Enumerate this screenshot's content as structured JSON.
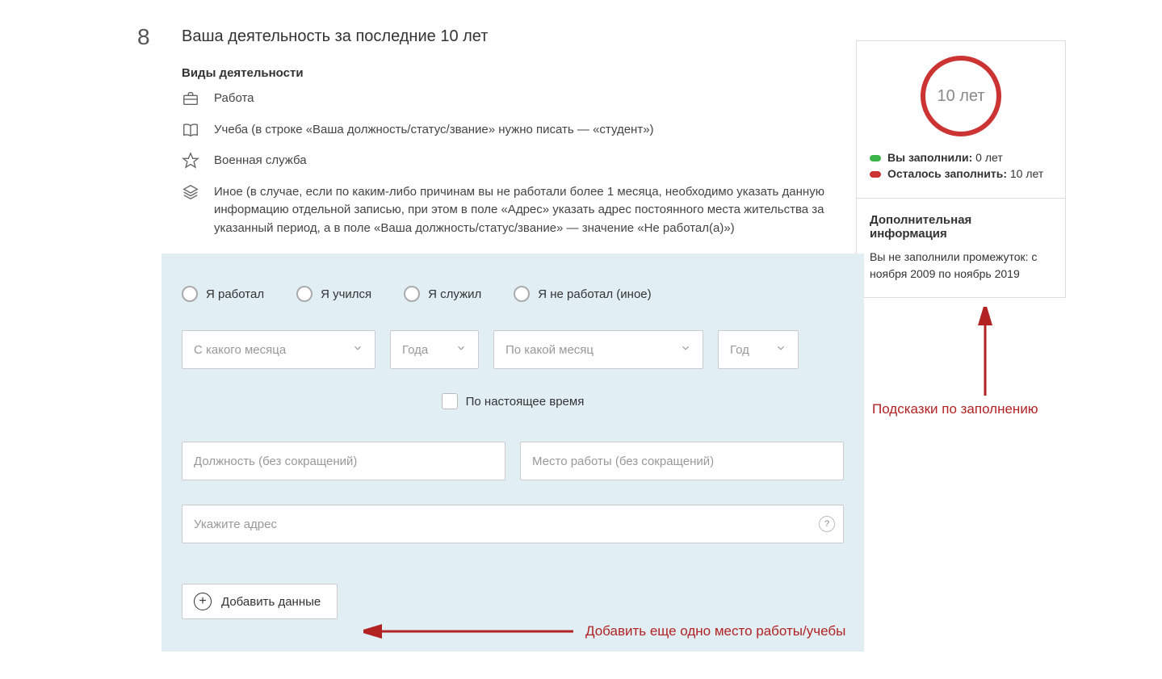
{
  "section": {
    "number": "8",
    "title": "Ваша деятельность за последние 10 лет",
    "subtitle": "Виды деятельности"
  },
  "types": {
    "work": "Работа",
    "study": "Учеба (в строке «Ваша должность/статус/звание» нужно писать — «студент»)",
    "military": "Военная служба",
    "other": "Иное (в случае, если по каким-либо причинам вы не работали более 1 месяца, необходимо указать данную информацию отдельной записью, при этом в поле «Адрес» указать адрес постоянного места жительства за указанный период, а в поле «Ваша должность/статус/звание» — значение «Не работал(а)»)"
  },
  "radios": {
    "worked": "Я работал",
    "studied": "Я учился",
    "served": "Я служил",
    "none": "Я не работал (иное)"
  },
  "selects": {
    "from_month": "С какого месяца",
    "from_year": "Года",
    "to_month": "По какой месяц",
    "to_year": "Год"
  },
  "checkbox": {
    "present": "По настоящее время"
  },
  "inputs": {
    "position": "Должность (без сокращений)",
    "workplace": "Место работы (без сокращений)",
    "address": "Укажите адрес"
  },
  "add_button": "Добавить данные",
  "side": {
    "circle": "10 лет",
    "filled_label": "Вы заполнили:",
    "filled_value": " 0 лет",
    "remain_label": "Осталось заполнить:",
    "remain_value": " 10 лет",
    "info_title": "Дополнительная информация",
    "info_text": "Вы не заполнили промежуток: с ноября 2009 по ноябрь 2019"
  },
  "annotations": {
    "hints": "Подсказки по заполнению",
    "add_more": "Добавить еще одно место работы/учебы"
  },
  "help": "?"
}
